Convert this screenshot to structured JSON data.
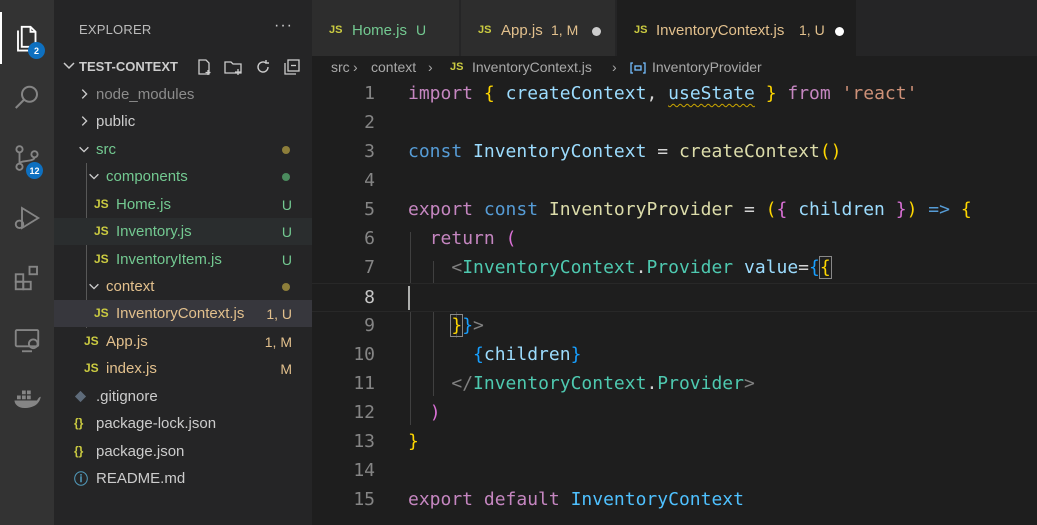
{
  "activity_bar": {
    "explorer_badge": "2",
    "scm_badge": "12"
  },
  "sidebar": {
    "title": "EXPLORER",
    "more": "···",
    "section": "TEST-CONTEXT",
    "tree": [
      {
        "label": "node_modules",
        "status": ""
      },
      {
        "label": "public",
        "status": ""
      },
      {
        "label": "src",
        "status": ""
      },
      {
        "label": "components",
        "status": ""
      },
      {
        "icon": "JS",
        "label": "Home.js",
        "status": "U"
      },
      {
        "icon": "JS",
        "label": "Inventory.js",
        "status": "U"
      },
      {
        "icon": "JS",
        "label": "InventoryItem.js",
        "status": "U"
      },
      {
        "label": "context",
        "status": ""
      },
      {
        "icon": "JS",
        "label": "InventoryContext.js",
        "status": "1, U"
      },
      {
        "icon": "JS",
        "label": "App.js",
        "status": "1, M"
      },
      {
        "icon": "JS",
        "label": "index.js",
        "status": "M"
      },
      {
        "label": ".gitignore",
        "status": ""
      },
      {
        "icon": "{}",
        "label": "package-lock.json",
        "status": ""
      },
      {
        "icon": "{}",
        "label": "package.json",
        "status": ""
      },
      {
        "icon": "ⓘ",
        "label": "README.md",
        "status": ""
      }
    ],
    "colors": {
      "untracked": "#73c991",
      "modified": "#e2c08d",
      "error": "#e2c08d"
    }
  },
  "tabs": [
    {
      "icon": "JS",
      "label": "Home.js",
      "status": "U"
    },
    {
      "icon": "JS",
      "label": "App.js",
      "status": "1, M"
    },
    {
      "icon": "JS",
      "label": "InventoryContext.js",
      "status": "1, U"
    }
  ],
  "breadcrumb": {
    "parts": [
      "src",
      "context",
      "InventoryContext.js",
      "InventoryProvider"
    ],
    "js_icon": "JS"
  },
  "editor": {
    "line_numbers": [
      "1",
      "2",
      "3",
      "4",
      "5",
      "6",
      "7",
      "8",
      "9",
      "10",
      "11",
      "12",
      "13",
      "14",
      "15"
    ],
    "active_line": "8"
  }
}
